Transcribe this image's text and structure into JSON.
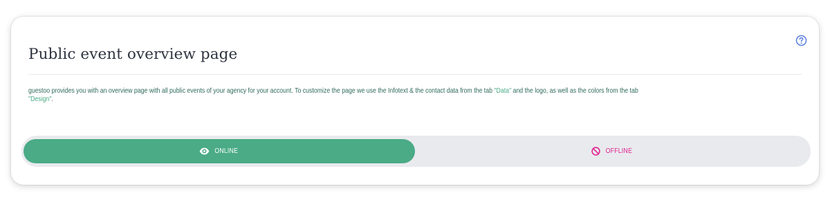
{
  "card": {
    "title": "Public event overview page",
    "help_icon": "question-circle-icon",
    "description": {
      "text_before": "guestoo provides you with an overview page with all public events of your agency for your account. To customize the page we use the Infotext & the contact data from the tab ",
      "data_tab": "\"Data\"",
      "text_middle": " and the logo, as well as the colors from the tab ",
      "design_tab": "\"Design\"",
      "text_after": "."
    }
  },
  "status_toggle": {
    "selected": "online",
    "online": {
      "label": "ONLINE",
      "icon": "eye-icon"
    },
    "offline": {
      "label": "OFFLINE",
      "icon": "ban-icon"
    }
  },
  "colors": {
    "accent_green": "#4aab86",
    "offline_pink": "#e0238f",
    "help_blue": "#5b7fe0",
    "toggle_track": "#e9eaee"
  }
}
